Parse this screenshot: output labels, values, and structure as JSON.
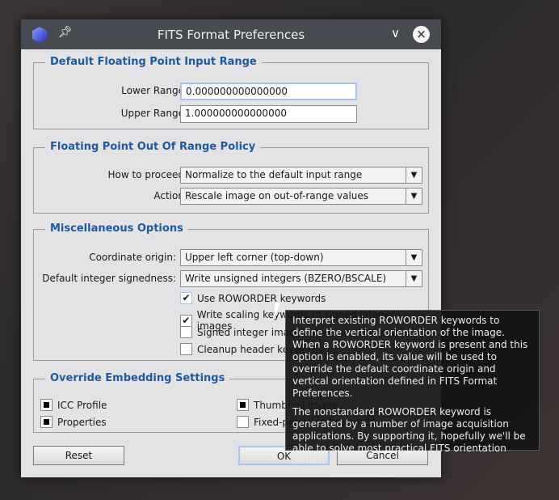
{
  "window": {
    "title": "FITS Format Preferences"
  },
  "input_range": {
    "title": "Default Floating Point Input Range",
    "lower_label": "Lower Range:",
    "lower_value": "0.000000000000000",
    "upper_label": "Upper Range:",
    "upper_value": "1.000000000000000"
  },
  "policy": {
    "title": "Floating Point Out Of Range Policy",
    "proceed_label": "How to proceed:",
    "proceed_value": "Normalize to the default input range",
    "action_label": "Action:",
    "action_value": "Rescale image on out-of-range values"
  },
  "misc": {
    "title": "Miscellaneous Options",
    "origin_label": "Coordinate origin:",
    "origin_value": "Upper left corner (top-down)",
    "sign_label": "Default integer signedness:",
    "sign_value": "Write unsigned integers (BZERO/BSCALE)",
    "checks": [
      {
        "label": "Use ROWORDER keywords",
        "checked": true
      },
      {
        "label": "Write scaling keywords to signed integer images",
        "checked": true
      },
      {
        "label": "Signed integer images store physical pixel data",
        "checked": false
      },
      {
        "label": "Cleanup header keywords",
        "checked": false
      }
    ]
  },
  "embed": {
    "title": "Override Embedding Settings",
    "items": [
      {
        "label": "ICC Profile",
        "state": "partial"
      },
      {
        "label": "Properties",
        "state": "partial"
      },
      {
        "label": "Thumbnail image",
        "state": "partial"
      },
      {
        "label": "Fixed-precision keywords",
        "state": "unchecked"
      }
    ]
  },
  "buttons": {
    "reset": "Reset",
    "ok": "OK",
    "cancel": "Cancel"
  },
  "tooltip": {
    "p1": "Interpret existing ROWORDER keywords to define the vertical orientation of the image. When a ROWORDER keyword is present and this option is enabled, its value will be used to override the default coordinate origin and vertical orientation defined in FITS Format Preferences.",
    "p2": "The nonstandard ROWORDER keyword is generated by a number of image acquisition applications. By supporting it, hopefully we'll be able to solve most practical FITS orientation issues."
  }
}
